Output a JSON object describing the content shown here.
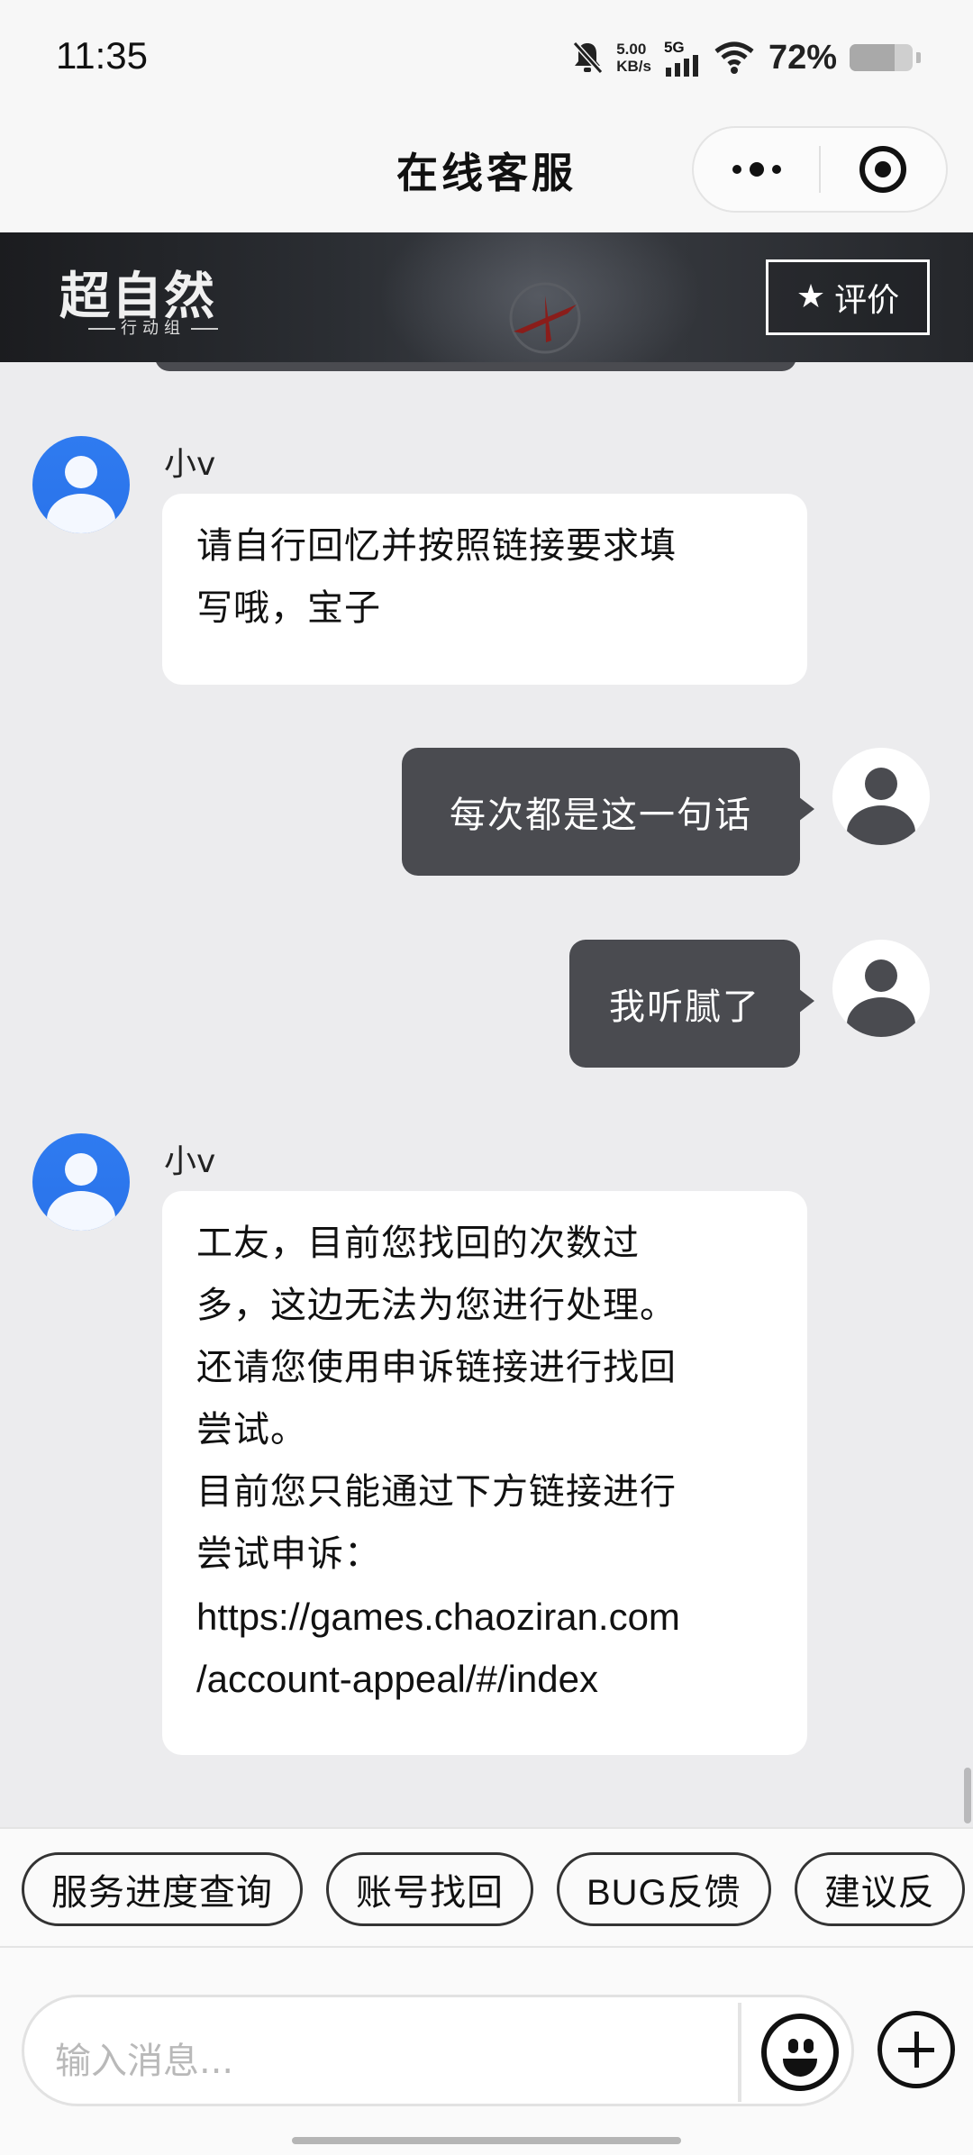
{
  "status_bar": {
    "time": "11:35",
    "net_speed_value": "5.00",
    "net_speed_unit": "KB/s",
    "network_type": "5G",
    "battery_percent": "72%",
    "battery_level": 0.72
  },
  "title_bar": {
    "title": "在线客服"
  },
  "banner": {
    "logo_text": "超自然",
    "logo_subtitle": "行动组",
    "rate_label": "评价"
  },
  "messages": [
    {
      "sender": "小v",
      "direction": "incoming",
      "lines": [
        "请自行回忆并按照链接要求填",
        "写哦，宝子"
      ]
    },
    {
      "direction": "outgoing",
      "text": "每次都是这一句话"
    },
    {
      "direction": "outgoing",
      "text": "我听腻了"
    },
    {
      "sender": "小v",
      "direction": "incoming",
      "lines": [
        "工友，目前您找回的次数过",
        "多，这边无法为您进行处理。",
        "还请您使用申诉链接进行找回",
        "尝试。",
        "目前您只能通过下方链接进行",
        "尝试申诉：",
        "https://games.chaoziran.com",
        "/account-appeal/#/index"
      ]
    }
  ],
  "quick_actions": [
    "服务进度查询",
    "账号找回",
    "BUG反馈",
    "建议反"
  ],
  "input": {
    "placeholder": "输入消息..."
  },
  "colors": {
    "accent_blue": "#2f7bf0",
    "outgoing_bubble": "#4a4b50",
    "incoming_bubble": "#ffffff",
    "background": "#ececee"
  }
}
